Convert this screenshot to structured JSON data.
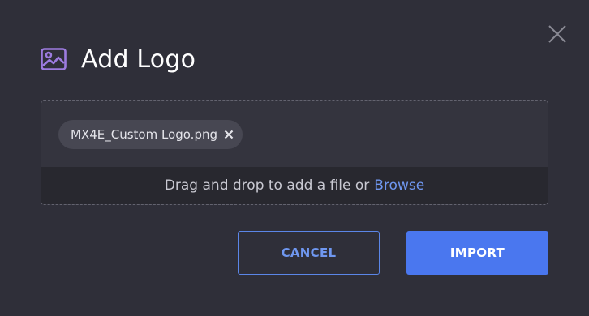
{
  "dialog": {
    "title": "Add Logo",
    "title_icon": "image-icon",
    "close_icon": "close-icon"
  },
  "dropzone": {
    "file_chip": {
      "filename": "MX4E_Custom Logo.png",
      "remove_icon": "remove-x-icon"
    },
    "prompt_text": "Drag and drop to add a file or",
    "browse_label": "Browse"
  },
  "actions": {
    "cancel_label": "CANCEL",
    "import_label": "IMPORT"
  },
  "colors": {
    "background": "#2f2f39",
    "accent": "#4a77ef",
    "link": "#6f97f0",
    "icon_purple": "#9d7ce0"
  }
}
